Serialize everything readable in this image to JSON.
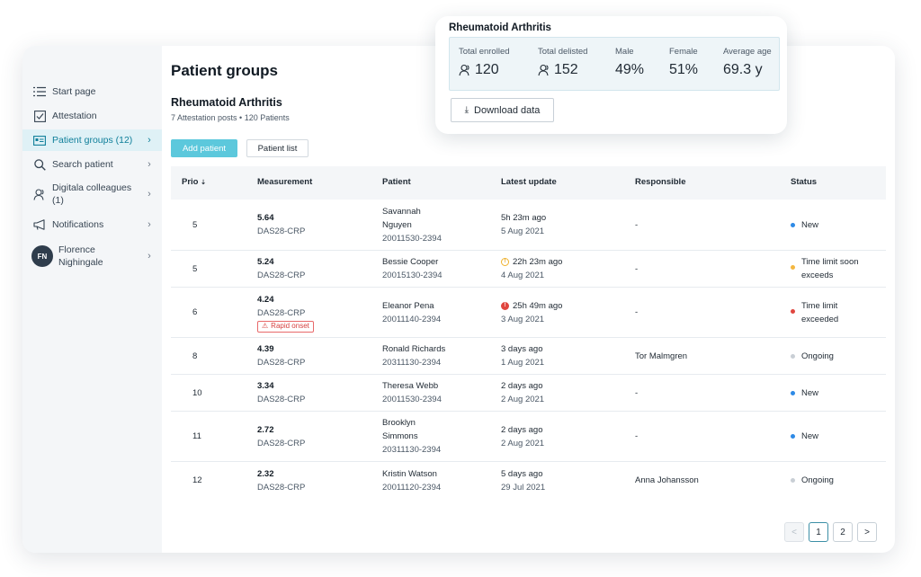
{
  "sidebar": {
    "items": [
      {
        "label": "Start page"
      },
      {
        "label": "Attestation"
      },
      {
        "label": "Patient groups (12)"
      },
      {
        "label": "Search patient"
      },
      {
        "label": "Digitala colleagues (1)"
      },
      {
        "label": "Notifications"
      }
    ],
    "user": {
      "initials": "FN",
      "name": "Florence Nighingale"
    }
  },
  "main": {
    "page_title": "Patient groups",
    "group_title": "Rheumatoid Arthritis",
    "group_subtitle": "7 Attestation posts • 120 Patients",
    "add_patient": "Add patient",
    "patient_list": "Patient list"
  },
  "table": {
    "headers": {
      "prio": "Prio",
      "measurement": "Measurement",
      "patient": "Patient",
      "latest_update": "Latest update",
      "responsible": "Responsible",
      "status": "Status"
    },
    "rows": [
      {
        "prio": "5",
        "value": "5.64",
        "unit": "DAS28-CRP",
        "name1": "Savannah",
        "name2": "Nguyen",
        "pid": "20011530-2394",
        "time": "5h 23m ago",
        "date": "5 Aug 2021",
        "responsible": "-",
        "status1": "New",
        "status2": "",
        "status_color": "#2e8ae6"
      },
      {
        "prio": "5",
        "value": "5.24",
        "unit": "DAS28-CRP",
        "name1": "Bessie Cooper",
        "name2": "",
        "pid": "20015130-2394",
        "time": "22h 23m ago",
        "date": "4 Aug 2021",
        "responsible": "-",
        "status1": "Time limit soon",
        "status2": "exceeds",
        "status_color": "#f4b740",
        "warn": "amber"
      },
      {
        "prio": "6",
        "value": "4.24",
        "unit": "DAS28-CRP",
        "badge": "Rapid onset",
        "name1": "Eleanor Pena",
        "name2": "",
        "pid": "20011140-2394",
        "time": "25h 49m ago",
        "date": "3 Aug 2021",
        "responsible": "-",
        "status1": "Time limit",
        "status2": "exceeded",
        "status_color": "#e0463f",
        "warn": "red"
      },
      {
        "prio": "8",
        "value": "4.39",
        "unit": "DAS28-CRP",
        "name1": "Ronald Richards",
        "name2": "",
        "pid": "20311130-2394",
        "time": "3 days ago",
        "date": "1 Aug 2021",
        "responsible": "Tor Malmgren",
        "status1": "Ongoing",
        "status2": "",
        "status_color": "#c9cfd5"
      },
      {
        "prio": "10",
        "value": "3.34",
        "unit": "DAS28-CRP",
        "name1": "Theresa Webb",
        "name2": "",
        "pid": "20011530-2394",
        "time": "2 days ago",
        "date": "2 Aug 2021",
        "responsible": "-",
        "status1": "New",
        "status2": "",
        "status_color": "#2e8ae6"
      },
      {
        "prio": "11",
        "value": "2.72",
        "unit": "DAS28-CRP",
        "name1": "Brooklyn",
        "name2": "Simmons",
        "pid": "20311130-2394",
        "time": "2 days ago",
        "date": "2 Aug 2021",
        "responsible": "-",
        "status1": "New",
        "status2": "",
        "status_color": "#2e8ae6"
      },
      {
        "prio": "12",
        "value": "2.32",
        "unit": "DAS28-CRP",
        "name1": "Kristin Watson",
        "name2": "",
        "pid": "20011120-2394",
        "time": "5 days ago",
        "date": "29 Jul 2021",
        "responsible": "Anna Johansson",
        "status1": "Ongoing",
        "status2": "",
        "status_color": "#c9cfd5"
      }
    ]
  },
  "pagination": {
    "prev": "<",
    "pages": [
      "1",
      "2"
    ],
    "next": ">",
    "current": "1"
  },
  "popup": {
    "title": "Rheumatoid Arthritis",
    "stats": [
      {
        "label": "Total enrolled",
        "value": "120",
        "icon": "people-icon"
      },
      {
        "label": "Total delisted",
        "value": "152",
        "icon": "people-icon"
      },
      {
        "label": "Male",
        "value": "49%"
      },
      {
        "label": "Female",
        "value": "51%"
      },
      {
        "label": "Average age",
        "value": "69.3 y"
      }
    ],
    "download_label": "Download data"
  }
}
